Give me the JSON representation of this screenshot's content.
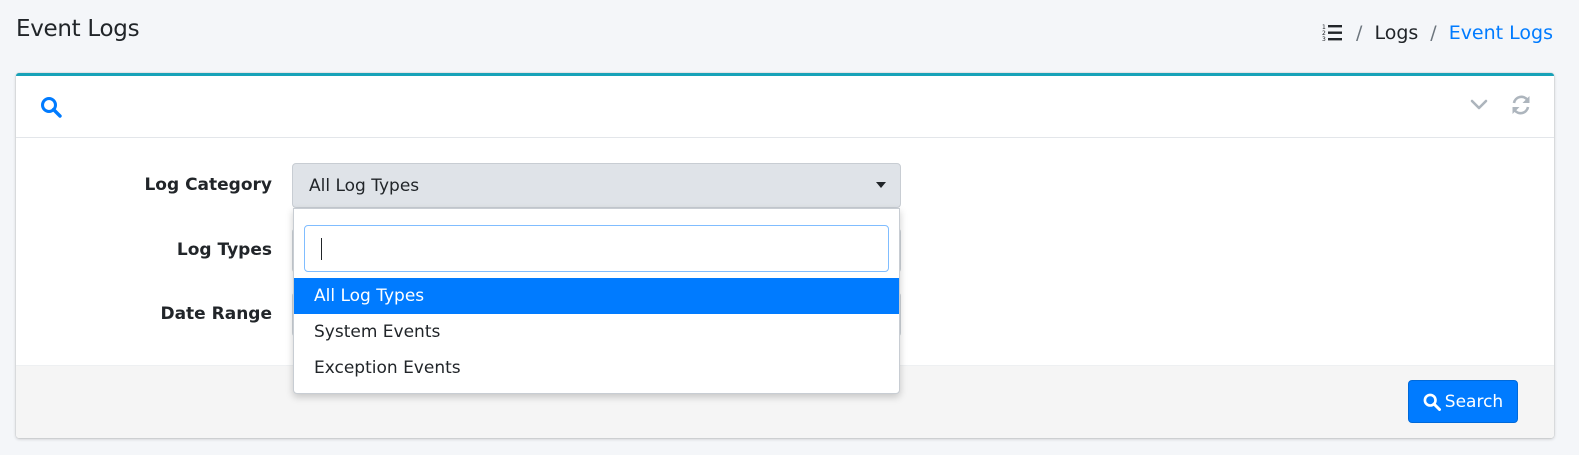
{
  "page": {
    "title": "Event Logs"
  },
  "breadcrumb": {
    "icon": "list-icon",
    "items": [
      "Logs",
      "Event Logs"
    ],
    "separator": "/"
  },
  "card": {
    "header_icon": "search-icon",
    "tools": [
      "chevron-down-icon",
      "refresh-icon"
    ],
    "accent_color": "#17a2b8"
  },
  "form": {
    "log_category": {
      "label": "Log Category",
      "value": "All Log Types"
    },
    "log_types": {
      "label": "Log Types"
    },
    "date_range": {
      "label": "Date Range"
    }
  },
  "dropdown": {
    "search_value": "",
    "options": [
      "All Log Types",
      "System Events",
      "Exception Events"
    ],
    "selected": "All Log Types"
  },
  "footer": {
    "search_label": "Search"
  },
  "colors": {
    "primary": "#007bff",
    "header_border": "#17a2b8"
  }
}
